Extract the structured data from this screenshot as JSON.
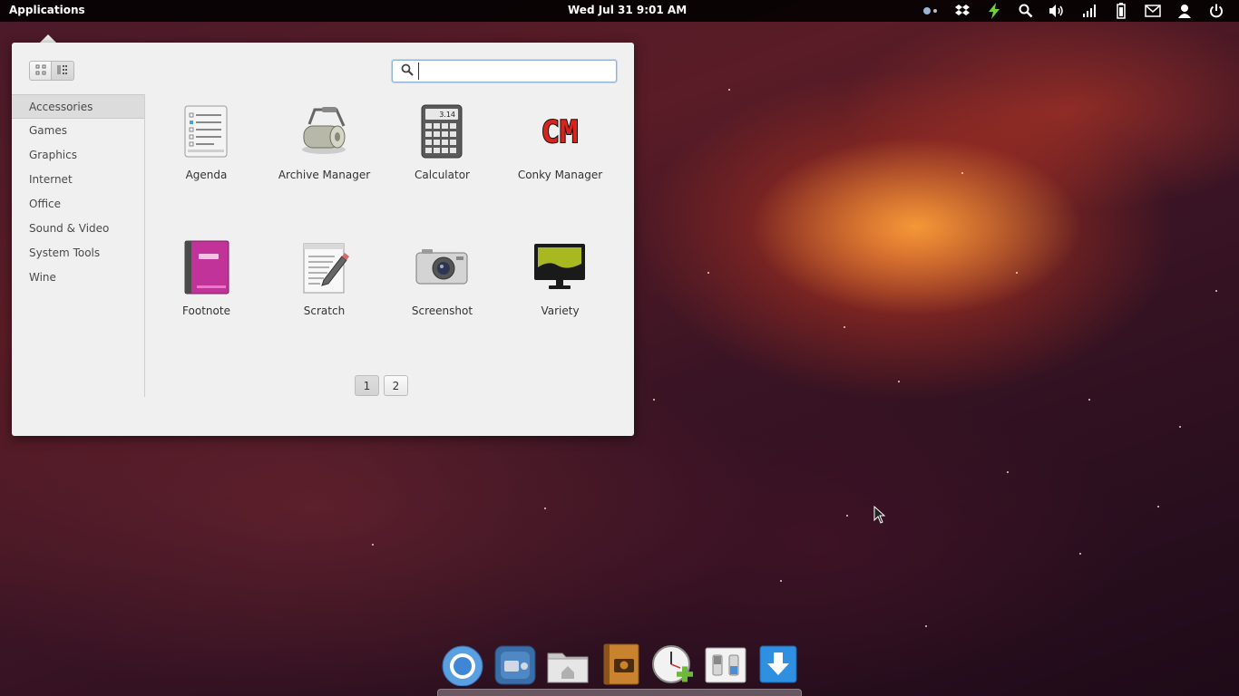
{
  "panel": {
    "applications_label": "Applications",
    "clock": "Wed Jul 31  9:01 AM",
    "tray_icons": [
      "indicator-dots-icon",
      "dropbox-icon",
      "power-bolt-icon",
      "search-icon",
      "volume-icon",
      "network-signal-icon",
      "battery-icon",
      "mail-icon",
      "user-icon",
      "power-icon"
    ]
  },
  "launcher": {
    "view_modes": [
      "grid-view-icon",
      "category-view-icon"
    ],
    "search": {
      "value": "",
      "placeholder": ""
    },
    "categories": [
      {
        "label": "Accessories",
        "active": true
      },
      {
        "label": "Games"
      },
      {
        "label": "Graphics"
      },
      {
        "label": "Internet"
      },
      {
        "label": "Office"
      },
      {
        "label": "Sound & Video"
      },
      {
        "label": "System Tools"
      },
      {
        "label": "Wine"
      }
    ],
    "apps": [
      {
        "label": "Agenda",
        "icon": "agenda-icon"
      },
      {
        "label": "Archive Manager",
        "icon": "archive-manager-icon"
      },
      {
        "label": "Calculator",
        "icon": "calculator-icon",
        "display": "3.14"
      },
      {
        "label": "Conky Manager",
        "icon": "conky-manager-icon",
        "logo": "CM"
      },
      {
        "label": "Footnote",
        "icon": "footnote-icon"
      },
      {
        "label": "Scratch",
        "icon": "scratch-icon"
      },
      {
        "label": "Screenshot",
        "icon": "screenshot-icon"
      },
      {
        "label": "Variety",
        "icon": "variety-icon"
      }
    ],
    "pages": [
      "1",
      "2"
    ],
    "current_page": "1"
  },
  "dock": {
    "items": [
      "chromium-icon",
      "screencast-icon",
      "files-home-icon",
      "shotwell-icon",
      "clock-add-icon",
      "switchboard-icon",
      "downloads-icon"
    ]
  },
  "colors": {
    "panel_bg": "#000000",
    "launcher_bg": "#f0f0f0",
    "accent_search_border": "#8fb2d6",
    "footnote_pink": "#c2339a",
    "conky_red": "#d8241c",
    "variety_green": "#a8b820"
  }
}
